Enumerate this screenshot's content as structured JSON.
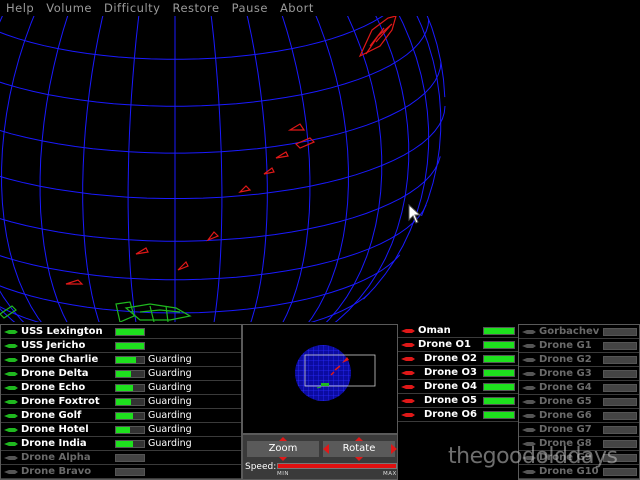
{
  "menu": [
    "Help",
    "Volume",
    "Difficulty",
    "Restore",
    "Pause",
    "Abort"
  ],
  "colors": {
    "grid": "#1a1aff",
    "enemy": "#e01818",
    "friendly": "#1fb81f",
    "health": "#1ee01e",
    "speed": "#e01010"
  },
  "left_fleet": [
    {
      "name": "USS Lexington",
      "health": 1.0,
      "status": "",
      "active": true
    },
    {
      "name": "USS Jericho",
      "health": 1.0,
      "status": "",
      "active": true
    },
    {
      "name": "Drone Charlie",
      "health": 0.7,
      "status": "Guarding",
      "active": true
    },
    {
      "name": "Drone Delta",
      "health": 0.55,
      "status": "Guarding",
      "active": true
    },
    {
      "name": "Drone Echo",
      "health": 0.6,
      "status": "Guarding",
      "active": true
    },
    {
      "name": "Drone Foxtrot",
      "health": 0.55,
      "status": "Guarding",
      "active": true
    },
    {
      "name": "Drone Golf",
      "health": 0.6,
      "status": "Guarding",
      "active": true
    },
    {
      "name": "Drone Hotel",
      "health": 0.5,
      "status": "Guarding",
      "active": true
    },
    {
      "name": "Drone India",
      "health": 0.6,
      "status": "Guarding",
      "active": true
    },
    {
      "name": "Drone Alpha",
      "health": 0,
      "status": "",
      "active": false
    },
    {
      "name": "Drone Bravo",
      "health": 0,
      "status": "",
      "active": false
    }
  ],
  "mid_fleet": [
    {
      "name": "Oman",
      "health": 1.0,
      "active": true
    },
    {
      "name": "Drone O1",
      "health": 1.0,
      "active": true
    },
    {
      "name": "Drone O2",
      "health": 1.0,
      "active": true
    },
    {
      "name": "Drone O3",
      "health": 1.0,
      "active": true
    },
    {
      "name": "Drone O4",
      "health": 1.0,
      "active": true
    },
    {
      "name": "Drone O5",
      "health": 1.0,
      "active": true
    },
    {
      "name": "Drone O6",
      "health": 1.0,
      "active": true
    }
  ],
  "right_fleet": [
    {
      "name": "Gorbachev",
      "health": 0,
      "active": false
    },
    {
      "name": "Drone G1",
      "health": 0,
      "active": false
    },
    {
      "name": "Drone G2",
      "health": 0,
      "active": false
    },
    {
      "name": "Drone G3",
      "health": 0,
      "active": false
    },
    {
      "name": "Drone G4",
      "health": 0,
      "active": false
    },
    {
      "name": "Drone G5",
      "health": 0,
      "active": false
    },
    {
      "name": "Drone G6",
      "health": 0,
      "active": false
    },
    {
      "name": "Drone G7",
      "health": 0,
      "active": false
    },
    {
      "name": "Drone G8",
      "health": 0,
      "active": false
    },
    {
      "name": "Drone G9",
      "health": 0,
      "active": false
    },
    {
      "name": "Drone G10",
      "health": 0,
      "active": false
    }
  ],
  "controls": {
    "zoom_label": "Zoom",
    "rotate_label": "Rotate",
    "speed_label": "Speed:",
    "speed_level": 1.0,
    "min_label": "MIN",
    "max_label": "MAX"
  },
  "watermark": "thegoodolddays"
}
